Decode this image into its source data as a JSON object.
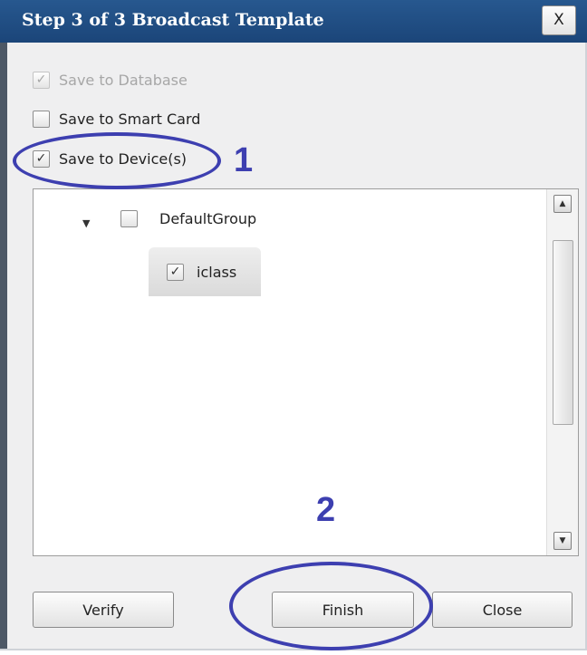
{
  "window": {
    "title": "Step 3 of 3 Broadcast Template",
    "close_glyph": "X"
  },
  "options": [
    {
      "label": "Save to Database",
      "checked": true,
      "disabled": true
    },
    {
      "label": "Save to Smart Card",
      "checked": false,
      "disabled": false
    },
    {
      "label": "Save to Device(s)",
      "checked": true,
      "disabled": false
    }
  ],
  "tree": {
    "group": {
      "label": "DefaultGroup",
      "checked": false,
      "expanded": true
    },
    "children": [
      {
        "label": "iclass",
        "checked": true
      }
    ]
  },
  "buttons": {
    "verify": "Verify",
    "finish": "Finish",
    "close": "Close"
  },
  "annotations": {
    "step1": "1",
    "step2": "2",
    "color": "#3d3fb0"
  },
  "glyphs": {
    "check": "✓",
    "expander": "▼",
    "scroll_up": "▲",
    "scroll_down": "▼"
  }
}
